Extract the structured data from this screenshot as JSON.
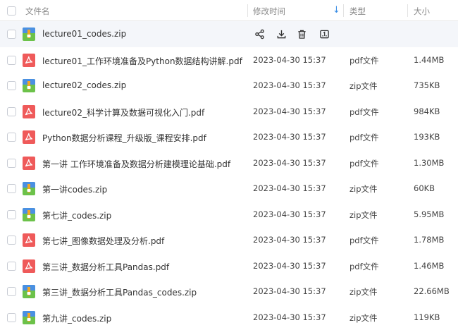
{
  "header": {
    "name_label": "文件名",
    "date_label": "修改时间",
    "sort_arrow": "↓",
    "type_label": "类型",
    "size_label": "大小"
  },
  "colors": {
    "pdf_icon": "#ef5a5a",
    "zip_icon_top": "#4a90e2",
    "zip_icon_bottom": "#6cc24a",
    "zip_icon_stripe": "#f5a623",
    "accent": "#3a8ee6",
    "row_hover": "#f4f6fa"
  },
  "hover_actions": [
    "share-icon",
    "download-icon",
    "delete-icon",
    "more-icon"
  ],
  "files": [
    {
      "name": "lecture01_codes.zip",
      "date": "",
      "type": "",
      "size": "",
      "icon": "zip",
      "hovered": true
    },
    {
      "name": "lecture01_工作环境准备及Python数据结构讲解.pdf",
      "date": "2023-04-30 15:37",
      "type": "pdf文件",
      "size": "1.44MB",
      "icon": "pdf"
    },
    {
      "name": "lecture02_codes.zip",
      "date": "2023-04-30 15:37",
      "type": "zip文件",
      "size": "735KB",
      "icon": "zip"
    },
    {
      "name": "lecture02_科学计算及数据可视化入门.pdf",
      "date": "2023-04-30 15:37",
      "type": "pdf文件",
      "size": "984KB",
      "icon": "pdf"
    },
    {
      "name": "Python数据分析课程_升级版_课程安排.pdf",
      "date": "2023-04-30 15:37",
      "type": "pdf文件",
      "size": "193KB",
      "icon": "pdf"
    },
    {
      "name": "第一讲 工作环境准备及数据分析建模理论基础.pdf",
      "date": "2023-04-30 15:37",
      "type": "pdf文件",
      "size": "1.30MB",
      "icon": "pdf"
    },
    {
      "name": "第一讲codes.zip",
      "date": "2023-04-30 15:37",
      "type": "zip文件",
      "size": "60KB",
      "icon": "zip"
    },
    {
      "name": "第七讲_codes.zip",
      "date": "2023-04-30 15:37",
      "type": "zip文件",
      "size": "5.95MB",
      "icon": "zip"
    },
    {
      "name": "第七讲_图像数据处理及分析.pdf",
      "date": "2023-04-30 15:37",
      "type": "pdf文件",
      "size": "1.78MB",
      "icon": "pdf"
    },
    {
      "name": "第三讲_数据分析工具Pandas.pdf",
      "date": "2023-04-30 15:37",
      "type": "pdf文件",
      "size": "1.46MB",
      "icon": "pdf"
    },
    {
      "name": "第三讲_数据分析工具Pandas_codes.zip",
      "date": "2023-04-30 15:37",
      "type": "zip文件",
      "size": "22.66MB",
      "icon": "zip"
    },
    {
      "name": "第九讲_codes.zip",
      "date": "2023-04-30 15:37",
      "type": "zip文件",
      "size": "119KB",
      "icon": "zip"
    }
  ]
}
